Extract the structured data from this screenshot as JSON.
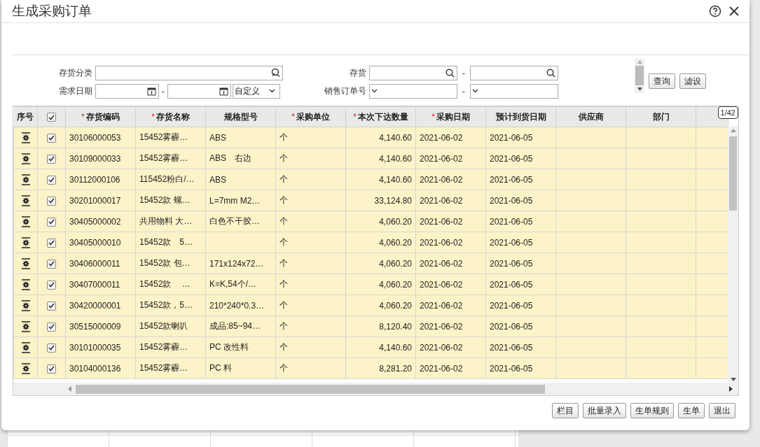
{
  "window": {
    "title": "生成采购订单"
  },
  "filters": {
    "inventory_category": {
      "label": "存货分类"
    },
    "inventory": {
      "label": "存货",
      "separator": "-"
    },
    "demand_date": {
      "label": "需求日期",
      "separator": "-",
      "range_type": "自定义"
    },
    "sales_order_no": {
      "label": "销售订单号",
      "separator": "-"
    }
  },
  "filter_buttons": [
    "查询",
    "滤设"
  ],
  "table": {
    "page_indicator": "1/42",
    "header_checked": true,
    "columns": [
      {
        "label": "序号"
      },
      {
        "label": "存货编码",
        "required_mark": "*"
      },
      {
        "label": "存货名称",
        "required_mark": "*"
      },
      {
        "label": "规格型号"
      },
      {
        "label": "采购单位",
        "required_mark": "*"
      },
      {
        "label": "本次下达数量",
        "required_mark": "*"
      },
      {
        "label": "采购日期",
        "required_mark": "*"
      },
      {
        "label": "预计到货日期"
      },
      {
        "label": "供应商"
      },
      {
        "label": "部门"
      }
    ],
    "rows": [
      {
        "checked": true,
        "code": "30106000053",
        "name": "15452雾霾…",
        "spec": "ABS",
        "unit": "个",
        "qty": "4,140.60",
        "purchase_date": "2021-06-02",
        "arrival_date": "2021-06-05"
      },
      {
        "checked": true,
        "code": "30109000033",
        "name": "15452雾霾…",
        "spec": "ABS　右边",
        "unit": "个",
        "qty": "4,140.60",
        "purchase_date": "2021-06-02",
        "arrival_date": "2021-06-05"
      },
      {
        "checked": true,
        "code": "30112000106",
        "name": "115452粉白/…",
        "spec": "ABS",
        "unit": "个",
        "qty": "4,140.60",
        "purchase_date": "2021-06-02",
        "arrival_date": "2021-06-05"
      },
      {
        "checked": true,
        "code": "30201000017",
        "name": "15452款  螺…",
        "spec": "L=7mm  M2…",
        "unit": "个",
        "qty": "33,124.80",
        "purchase_date": "2021-06-02",
        "arrival_date": "2021-06-05"
      },
      {
        "checked": true,
        "code": "30405000002",
        "name": "共用物料 大…",
        "spec": "白色不干胶…",
        "unit": "个",
        "qty": "4,060.20",
        "purchase_date": "2021-06-02",
        "arrival_date": "2021-06-05"
      },
      {
        "checked": true,
        "code": "30405000010",
        "name": "15452款　5…",
        "unit": "个",
        "qty": "4,060.20",
        "purchase_date": "2021-06-02",
        "arrival_date": "2021-06-05"
      },
      {
        "checked": true,
        "code": "30406000011",
        "name": "15452款  包…",
        "spec": "171x124x72…",
        "unit": "个",
        "qty": "4,060.20",
        "purchase_date": "2021-06-02",
        "arrival_date": "2021-06-05"
      },
      {
        "checked": true,
        "code": "30407000011",
        "name": "15452款　 …",
        "spec": "K=K,54个/…",
        "unit": "个",
        "qty": "4,060.20",
        "purchase_date": "2021-06-02",
        "arrival_date": "2021-06-05"
      },
      {
        "checked": true,
        "code": "30420000001",
        "name": "15452款，5…",
        "spec": "210*240*0.3…",
        "unit": "个",
        "qty": "4,060.20",
        "purchase_date": "2021-06-02",
        "arrival_date": "2021-06-05"
      },
      {
        "checked": true,
        "code": "30515000009",
        "name": "15452款喇叭",
        "spec": "成品:85~94…",
        "unit": "个",
        "qty": "8,120.40",
        "purchase_date": "2021-06-02",
        "arrival_date": "2021-06-05"
      },
      {
        "checked": true,
        "code": "30101000035",
        "name": "15452雾霾…",
        "spec": "PC 改性料",
        "unit": "个",
        "qty": "4,140.60",
        "purchase_date": "2021-06-02",
        "arrival_date": "2021-06-05"
      },
      {
        "checked": true,
        "code": "30104000136",
        "name": "15452雾霾…",
        "spec": "PC 料",
        "unit": "个",
        "qty": "8,281.20",
        "purchase_date": "2021-06-02",
        "arrival_date": "2021-06-05"
      }
    ]
  },
  "footer_buttons": [
    "栏目",
    "批量录入",
    "生单规则",
    "生单",
    "退出"
  ]
}
